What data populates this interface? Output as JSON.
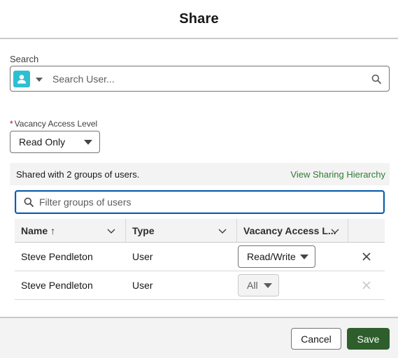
{
  "modal": {
    "title": "Share"
  },
  "search": {
    "label": "Search",
    "placeholder": "Search User..."
  },
  "access": {
    "required_mark": "*",
    "label": "Vacancy Access Level",
    "selected": "Read Only"
  },
  "shared": {
    "summary": "Shared with 2 groups of users.",
    "hierarchy_link": "View Sharing Hierarchy"
  },
  "filter": {
    "placeholder": "Filter groups of users"
  },
  "table": {
    "headers": {
      "name": "Name",
      "sort_indicator": "↑",
      "type": "Type",
      "access": "Vacancy Access L..."
    },
    "rows": [
      {
        "name": "Steve Pendleton",
        "type": "User",
        "access": "Read/Write",
        "access_disabled": false
      },
      {
        "name": "Steve Pendleton",
        "type": "User",
        "access": "All",
        "access_disabled": true
      }
    ]
  },
  "footer": {
    "cancel_label": "Cancel",
    "save_label": "Save"
  },
  "colors": {
    "avatar": "#2fbfd2",
    "save_button": "#2e5e2b",
    "link": "#2e7d32",
    "focus_border": "#0b5cab",
    "required": "#ba0517"
  }
}
